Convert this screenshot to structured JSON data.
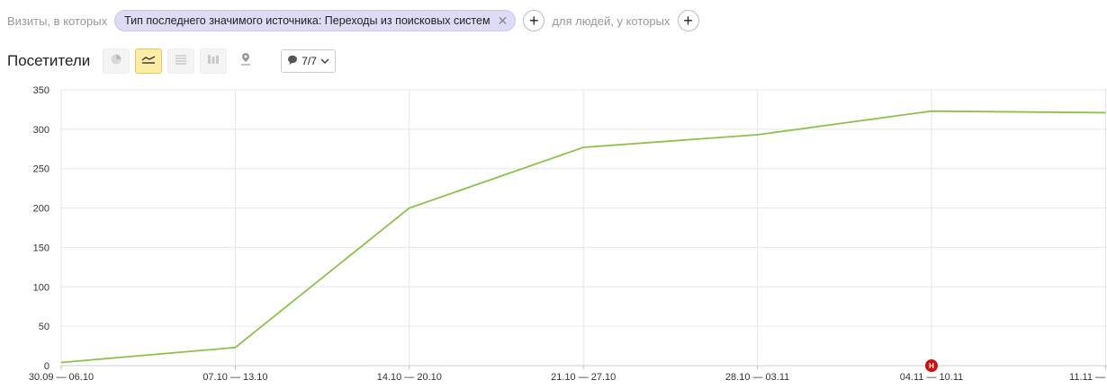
{
  "filters": {
    "visits_label": "Визиты, в которых",
    "chip_text": "Тип последнего значимого источника: Переходы из поисковых систем",
    "people_label": "для людей, у которых"
  },
  "toolbar": {
    "title": "Посетители",
    "views": [
      {
        "icon": "pie-chart-icon",
        "active": false
      },
      {
        "icon": "line-chart-icon",
        "active": true
      },
      {
        "icon": "area-chart-icon",
        "active": false
      },
      {
        "icon": "bar-chart-icon",
        "active": false
      },
      {
        "icon": "map-pin-icon",
        "active": false
      }
    ],
    "series_count": "7/7"
  },
  "colors": {
    "line": "#8bc34a",
    "grid": "#e6e6e6",
    "marker": "#cc1111",
    "active_bg": "#fdeca5"
  },
  "chart_data": {
    "type": "line",
    "title": "",
    "xlabel": "",
    "ylabel": "",
    "categories": [
      "30.09 — 06.10",
      "07.10 — 13.10",
      "14.10 — 20.10",
      "21.10 — 27.10",
      "28.10 — 03.11",
      "04.11 — 10.11",
      "11.11 —"
    ],
    "series": [
      {
        "values": [
          4,
          23,
          200,
          277,
          293,
          323,
          321
        ]
      }
    ],
    "ylim": [
      0,
      350
    ],
    "yticks": [
      0,
      50,
      100,
      150,
      200,
      250,
      300,
      350
    ],
    "grid": true,
    "legend": "none",
    "annotations": [
      {
        "category": "04.11 — 10.11",
        "label": "Н"
      }
    ]
  }
}
